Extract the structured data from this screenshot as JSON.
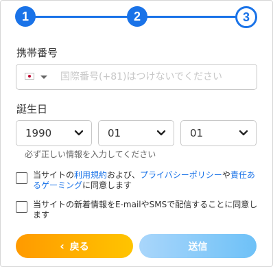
{
  "stepper": {
    "steps": [
      "1",
      "2",
      "3"
    ],
    "current": 3,
    "accent": "#1a73e8"
  },
  "phone": {
    "label": "携帯番号",
    "country_flag": "japan-flag-icon",
    "placeholder": "国際番号(+81)はつけないでください",
    "value": ""
  },
  "birthday": {
    "label": "誕生日",
    "year": "1990",
    "month": "01",
    "day": "01",
    "hint": "必ず正しい情報を入力してください"
  },
  "agreements": {
    "terms": {
      "t1": "当サイトの",
      "link1": "利用規約",
      "t2": "および、",
      "link2": "プライバシーポリシー",
      "t3": "や",
      "link3": "責任あるゲーミング",
      "t4": "に同意します"
    },
    "newsletter": "当サイトの新着情報をE-mailやSMSで配信することに同意します"
  },
  "buttons": {
    "back_label": "戻る",
    "back_icon": "chevron-left-icon",
    "send_label": "送信",
    "back_colors": [
      "#ff9a00",
      "#ffc400"
    ],
    "send_colors": [
      "#a9d6fb",
      "#6ec1f7"
    ]
  }
}
